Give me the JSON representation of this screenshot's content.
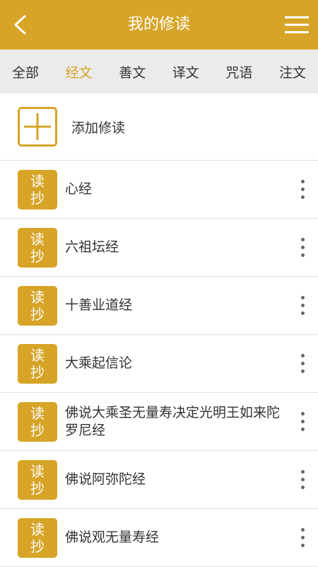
{
  "header": {
    "title": "我的修读",
    "back_icon": "chevron-left-icon",
    "menu_icon": "hamburger-menu-icon"
  },
  "tabs": [
    {
      "label": "全部",
      "active": false
    },
    {
      "label": "经文",
      "active": true
    },
    {
      "label": "善文",
      "active": false
    },
    {
      "label": "译文",
      "active": false
    },
    {
      "label": "咒语",
      "active": false
    },
    {
      "label": "注文",
      "active": false
    }
  ],
  "add": {
    "label": "添加修读",
    "icon": "plus-square-icon"
  },
  "badge": {
    "line1": "读",
    "line2": "抄"
  },
  "items": [
    {
      "title": "心经"
    },
    {
      "title": "六祖坛经"
    },
    {
      "title": "十善业道经"
    },
    {
      "title": "大乘起信论"
    },
    {
      "title": "佛说大乘圣无量寿决定光明王如来陀罗尼经"
    },
    {
      "title": "佛说阿弥陀经"
    },
    {
      "title": "佛说观无量寿经"
    }
  ],
  "colors": {
    "accent": "#d7a427",
    "tab_bar": "#ebebeb",
    "text": "#333333",
    "divider": "#e2e2e2"
  }
}
